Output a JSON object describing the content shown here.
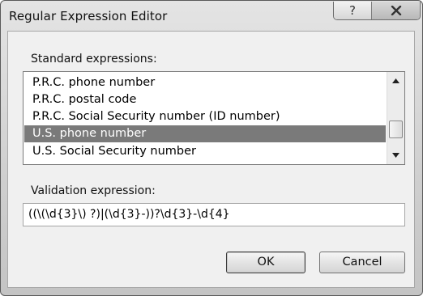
{
  "window": {
    "title": "Regular Expression Editor"
  },
  "caption_buttons": {
    "help_glyph": "?"
  },
  "standard_expressions": {
    "label": "Standard expressions:",
    "items": [
      "P.R.C. phone number",
      "P.R.C. postal code",
      "P.R.C. Social Security number (ID number)",
      "U.S. phone number",
      "U.S. Social Security number"
    ],
    "selected_item": "U.S. phone number"
  },
  "validation": {
    "label": "Validation expression:",
    "value": "((\\(\\d{3}\\) ?)|(\\d{3}-))?\\d{3}-\\d{4}"
  },
  "buttons": {
    "ok": "OK",
    "cancel": "Cancel"
  },
  "colors": {
    "selection_bg": "#7a7a7a",
    "client_bg": "#f0f0f0",
    "frame_bg": "#d4d4d4"
  }
}
